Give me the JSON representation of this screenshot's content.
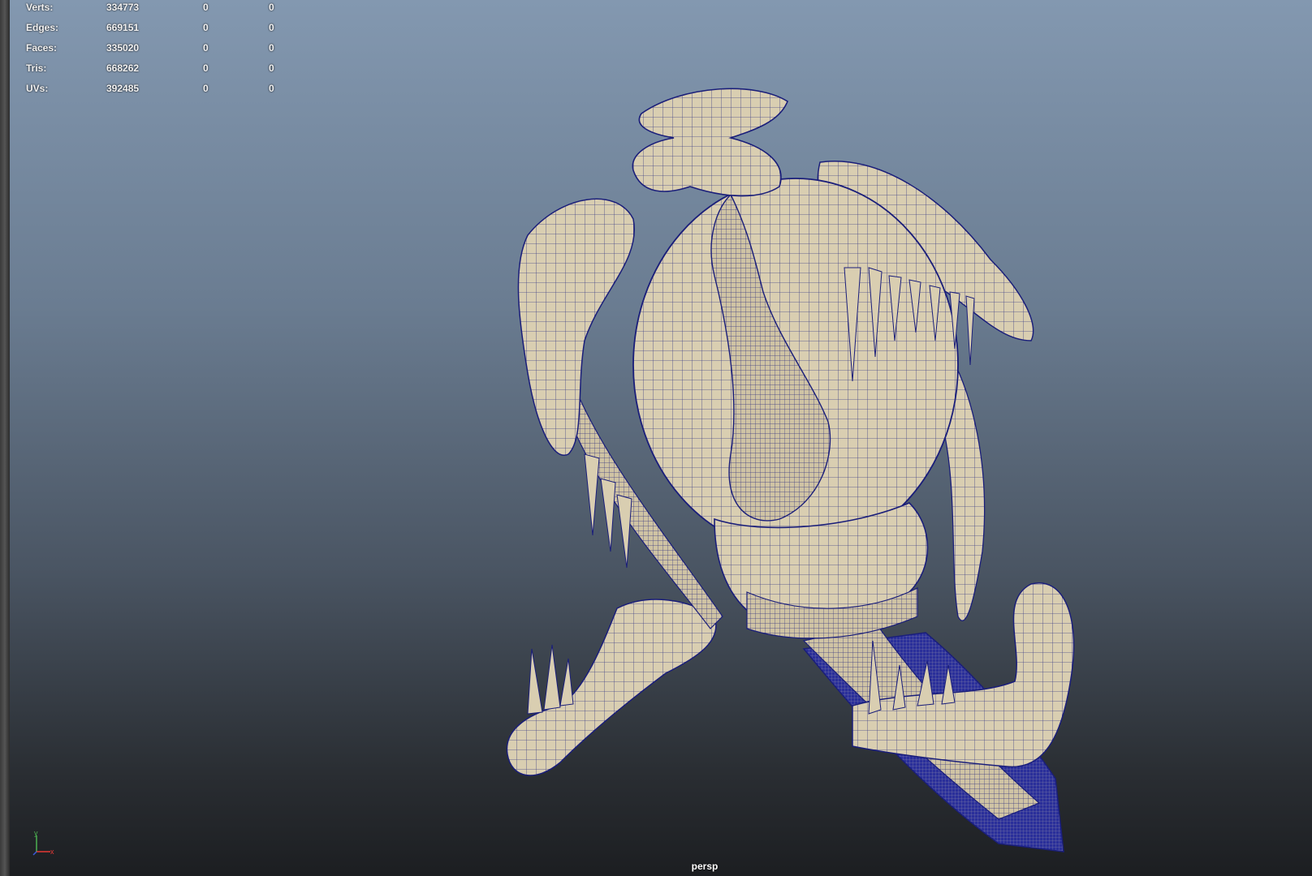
{
  "viewport": {
    "camera_name": "persp",
    "background_top_color": "#8398b0",
    "background_bottom_color": "#1c1e21",
    "mesh_color": "#d9ceb1",
    "wire_color": "#1a1e7a"
  },
  "heads_up_display": {
    "rows": [
      {
        "label": "Verts:",
        "v1": "334773",
        "v2": "0",
        "v3": "0"
      },
      {
        "label": "Edges:",
        "v1": "669151",
        "v2": "0",
        "v3": "0"
      },
      {
        "label": "Faces:",
        "v1": "335020",
        "v2": "0",
        "v3": "0"
      },
      {
        "label": "Tris:",
        "v1": "668262",
        "v2": "0",
        "v3": "0"
      },
      {
        "label": "UVs:",
        "v1": "392485",
        "v2": "0",
        "v3": "0"
      }
    ]
  },
  "axis_gizmo": {
    "y_label": "y",
    "x_label": "x",
    "y_color": "#4caf50",
    "x_color": "#e53935",
    "z_color": "#3b5bdb"
  }
}
